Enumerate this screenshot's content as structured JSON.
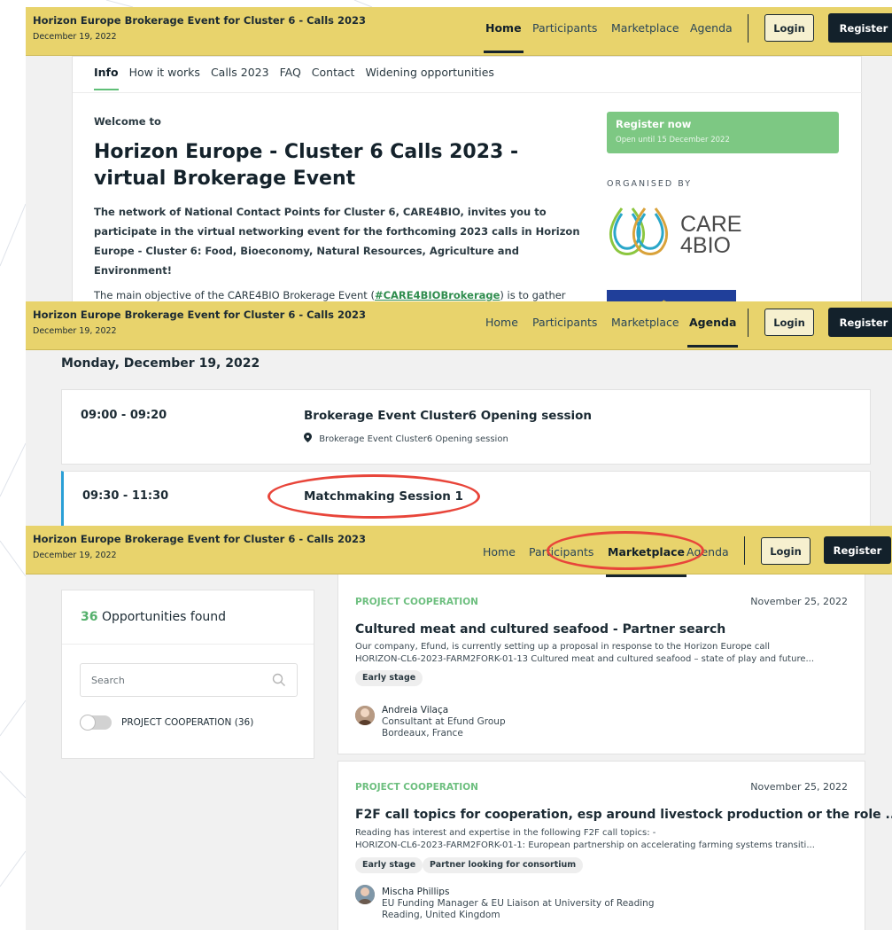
{
  "header": {
    "title": "Horizon Europe Brokerage Event for Cluster 6 - Calls 2023",
    "date": "December 19, 2022",
    "nav": [
      "Home",
      "Participants",
      "Marketplace",
      "Agenda"
    ],
    "login": "Login",
    "register": "Register"
  },
  "info_page": {
    "tabs": [
      "Info",
      "How it works",
      "Calls 2023",
      "FAQ",
      "Contact",
      "Widening opportunities"
    ],
    "welcome": "Welcome to",
    "headline": "Horizon Europe - Cluster 6 Calls 2023 - virtual Brokerage Event",
    "intro": "The network of National Contact Points for Cluster 6, CARE4BIO, invites you to participate in the virtual networking event for the forthcoming 2023 calls in Horizon Europe - Cluster 6: Food, Bioeconomy, Natural Resources, Agriculture and Environment!",
    "objective_before": "The main objective of the CARE4BIO Brokerage Event (",
    "objective_hashtag": "#CARE4BIOBrokerage",
    "objective_after": ") is to gather",
    "register_title": "Register now",
    "register_sub": "Open until 15 December 2022",
    "organised_by": "ORGANISED BY",
    "logo_line1": "CARE",
    "logo_line2": "4BIO"
  },
  "agenda_page": {
    "day": "Monday, December 19, 2022",
    "sessions": [
      {
        "time": "09:00 - 09:20",
        "title": "Brokerage Event Cluster6 Opening session",
        "location": "Brokerage Event Cluster6 Opening session"
      },
      {
        "time": "09:30 - 11:30",
        "title": "Matchmaking Session 1"
      }
    ]
  },
  "marketplace_page": {
    "count": "36",
    "count_label": "Opportunities found",
    "search_placeholder": "Search",
    "filter_label": "PROJECT COOPERATION (36)",
    "opportunities": [
      {
        "type": "PROJECT COOPERATION",
        "date": "November 25, 2022",
        "title": "Cultured meat and cultured seafood - Partner search",
        "desc1": "Our company, Efund, is currently setting up a proposal in response to the Horizon Europe call",
        "desc2": "HORIZON-CL6-2023-FARM2FORK-01-13 Cultured meat and cultured seafood – state of play and future...",
        "tags": [
          "Early stage"
        ],
        "name": "Andreia Vilaça",
        "role": "Consultant at Efund Group",
        "location": "Bordeaux, France"
      },
      {
        "type": "PROJECT COOPERATION",
        "date": "November 25, 2022",
        "title": "F2F call topics for cooperation, esp around livestock production or the role ...",
        "desc1": "Reading has interest and expertise in the following F2F call topics: -",
        "desc2": "HORIZON-CL6-2023-FARM2FORK-01-1: European partnership on accelerating farming systems transiti...",
        "tags": [
          "Early stage",
          "Partner looking for consortium"
        ],
        "name": "Mischa Phillips",
        "role": "EU Funding Manager & EU Liaison at University of Reading",
        "location": "Reading, United Kingdom"
      }
    ]
  },
  "colors": {
    "header_bg": "#e8d36c",
    "accent_green": "#6dbf7f",
    "register_bg": "#13212b",
    "highlight_ring": "#e8453a",
    "active_bar": "#2a9fd6"
  }
}
